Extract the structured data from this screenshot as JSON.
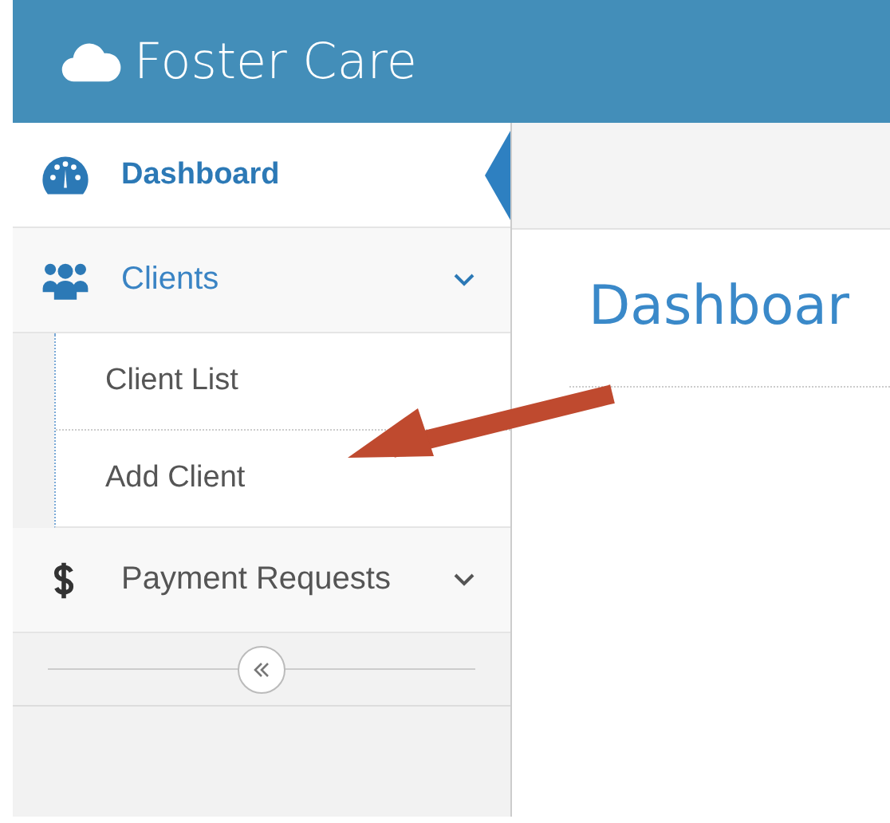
{
  "header": {
    "title": "Foster Care"
  },
  "sidebar": {
    "items": [
      {
        "kind": "gauge",
        "label": "Dashboard",
        "selected": true
      },
      {
        "kind": "people",
        "label": "Clients",
        "selected": false,
        "expanded": true,
        "children": [
          {
            "label": "Client List",
            "selected": false
          },
          {
            "label": "Add Client",
            "selected": false
          }
        ]
      },
      {
        "kind": "dollar",
        "label": "Payment Requests",
        "selected": false,
        "expanded": false
      }
    ]
  },
  "main": {
    "heading": "Dashboar"
  }
}
